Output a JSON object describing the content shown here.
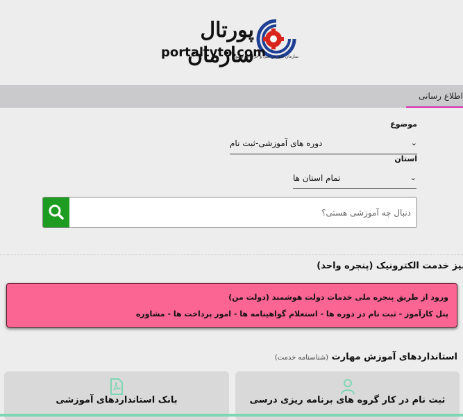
{
  "header": {
    "logo_title": "پورتال سازمان",
    "logo_domain": "portaltvto.com",
    "logo_subtitle": "سازمان آموزش فنی و حرفه‌ای کشور"
  },
  "nav": {
    "active_item": "اطلاع رسانی"
  },
  "filters": {
    "topic_label": "موضوع",
    "topic_value": "دوره های آموزشی-ثبت نام",
    "province_label": "استان",
    "province_value": "تمام استان ها"
  },
  "search": {
    "placeholder": "دنبال چه آموزشی هستی؟"
  },
  "services": {
    "heading": "میز خدمت الکترونیک (پنجره واحد)",
    "alert_line1": "ورود از طریق پنجره ملی خدمات دولت هوشمند (دولت من)",
    "alert_line2": "پنل کارآموز - ثبت نام در دوره ها - استعلام گواهینامه ها - امور پرداخت ها - مشاوره"
  },
  "standards": {
    "heading": "استانداردهای آموزش مهارت",
    "subheading": "(شناسنامه خدمت)",
    "card_right_title": "ثبت نام در کار گروه های برنامه ریزی درسی",
    "card_left_title": "بانک استانداردهای آموزشی"
  },
  "colors": {
    "accent_green": "#1e9c22",
    "alert_pink": "#fb6593",
    "nav_underline": "#d92fb0",
    "icon_green": "#7fd6b4"
  }
}
